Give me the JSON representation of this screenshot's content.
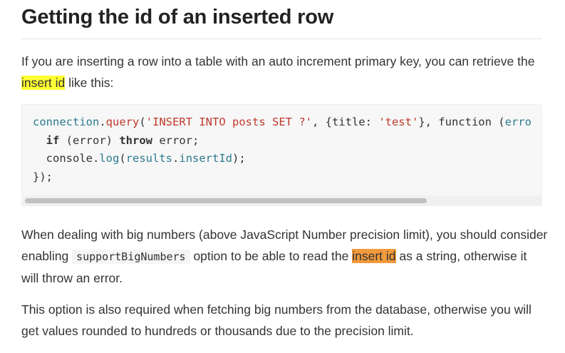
{
  "heading": "Getting the id of an inserted row",
  "para1": {
    "before": "If you are inserting a row into a table with an auto increment primary key, you can retrieve the",
    "highlight": "insert id",
    "after": " like this:"
  },
  "code": {
    "line1": {
      "obj": "connection",
      "dot": ".",
      "method": "query",
      "open": "(",
      "str": "'INSERT INTO posts SET ?'",
      "mid": ", {title: ",
      "val": "'test'",
      "rest": "}, function (",
      "trail": "erro"
    },
    "line2": {
      "indent": "  ",
      "kw1": "if",
      "mid": " (error) ",
      "kw2": "throw",
      "rest": " error;"
    },
    "line3": {
      "indent": "  ",
      "obj": "console",
      "dot": ".",
      "fn": "log",
      "open": "(",
      "arg": "results",
      "dot2": ".",
      "prop": "insertId",
      "close": ");"
    },
    "line4": "});"
  },
  "para2": {
    "line1": "When dealing with big numbers (above JavaScript Number precision limit), you should consider",
    "pre": "enabling ",
    "code": "supportBigNumbers",
    "mid": " option to be able to read the ",
    "highlight": "insert id",
    "post": " as a string, otherwise it",
    "line3": "will throw an error."
  },
  "para3": {
    "line1": "This option is also required when fetching big numbers from the database, otherwise you will",
    "line2": "get values rounded to hundreds or thousands due to the precision limit."
  },
  "colors": {
    "highlight_yellow": "#ffff33",
    "highlight_orange": "#f39a3c",
    "code_background": "#f7f7f7"
  }
}
